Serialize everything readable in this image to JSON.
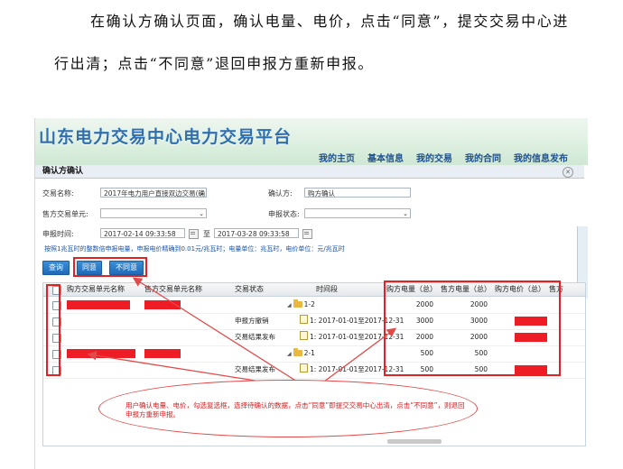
{
  "doc": {
    "line1": "在确认方确认页面，确认电量、电价，点击“同意”，提交交易中心进",
    "line2": "行出清；点击“不同意”退回申报方重新申报。"
  },
  "header": {
    "platform_title": "山东电力交易中心电力交易平台",
    "nav": [
      "我的主页",
      "基本信息",
      "我的交易",
      "我的合同",
      "我的信息发布"
    ],
    "active_nav": "我的交易"
  },
  "panel": {
    "title": "确认方确认",
    "close_icon": "close-circle-icon"
  },
  "form": {
    "trade_name_label": "交易名称:",
    "trade_name_value": "2017年电力用户直接双边交易(确",
    "confirmer_label": "确认方:",
    "confirmer_value": "购方确认",
    "seller_unit_label": "售方交易单元:",
    "seller_unit_value": "",
    "declare_status_label": "申报状态:",
    "declare_status_value": "",
    "declare_time_label": "申报时间:",
    "time_from": "2017-02-14 09:33:58",
    "to_label": "至",
    "time_to": "2017-03-28 09:33:58"
  },
  "notice": "按照1兆瓦时的整数倍申报电量，申报电价精确到0.01元/兆瓦时；电量单位：兆瓦时，电价单位：元/兆瓦时",
  "buttons": {
    "query": "查询",
    "agree": "同意",
    "disagree": "不同意"
  },
  "table": {
    "headers": [
      "购方交易单元名称",
      "售方交易单元名称",
      "交易状态",
      "时间段",
      "购方电量（总）",
      "售方电量（总）",
      "购方电价（总）",
      "售方"
    ],
    "rows": [
      {
        "status": "",
        "period": "1-2",
        "buy_qty": "2000",
        "sell_qty": "2000",
        "tree": "folder"
      },
      {
        "status": "申报方撤销",
        "period": "1:  2017-01-01至2017-12-31",
        "buy_qty": "3000",
        "sell_qty": "3000",
        "tree": "leaf"
      },
      {
        "status": "交易结果发布",
        "period": "1:  2017-01-01至2017-12-31",
        "buy_qty": "2000",
        "sell_qty": "2000",
        "tree": "leaf"
      },
      {
        "status": "",
        "period": "2-1",
        "buy_qty": "500",
        "sell_qty": "500",
        "tree": "folder"
      },
      {
        "status": "交易结果发布",
        "period": "1:  2017-01-01至2017-12-31",
        "buy_qty": "500",
        "sell_qty": "500",
        "tree": "leaf"
      }
    ]
  },
  "annotation": {
    "text": "用户确认电量、电价，勾选复选框，选择待确认的数据，点击“同意”即提交交易中心出清，点击“不同意”，则退回申报方重新申报。"
  },
  "colors": {
    "annotation_red": "#e02222",
    "redaction_red": "#ee1c25",
    "button_blue": "#1f6ab8",
    "title_blue": "#2f6fb0"
  }
}
